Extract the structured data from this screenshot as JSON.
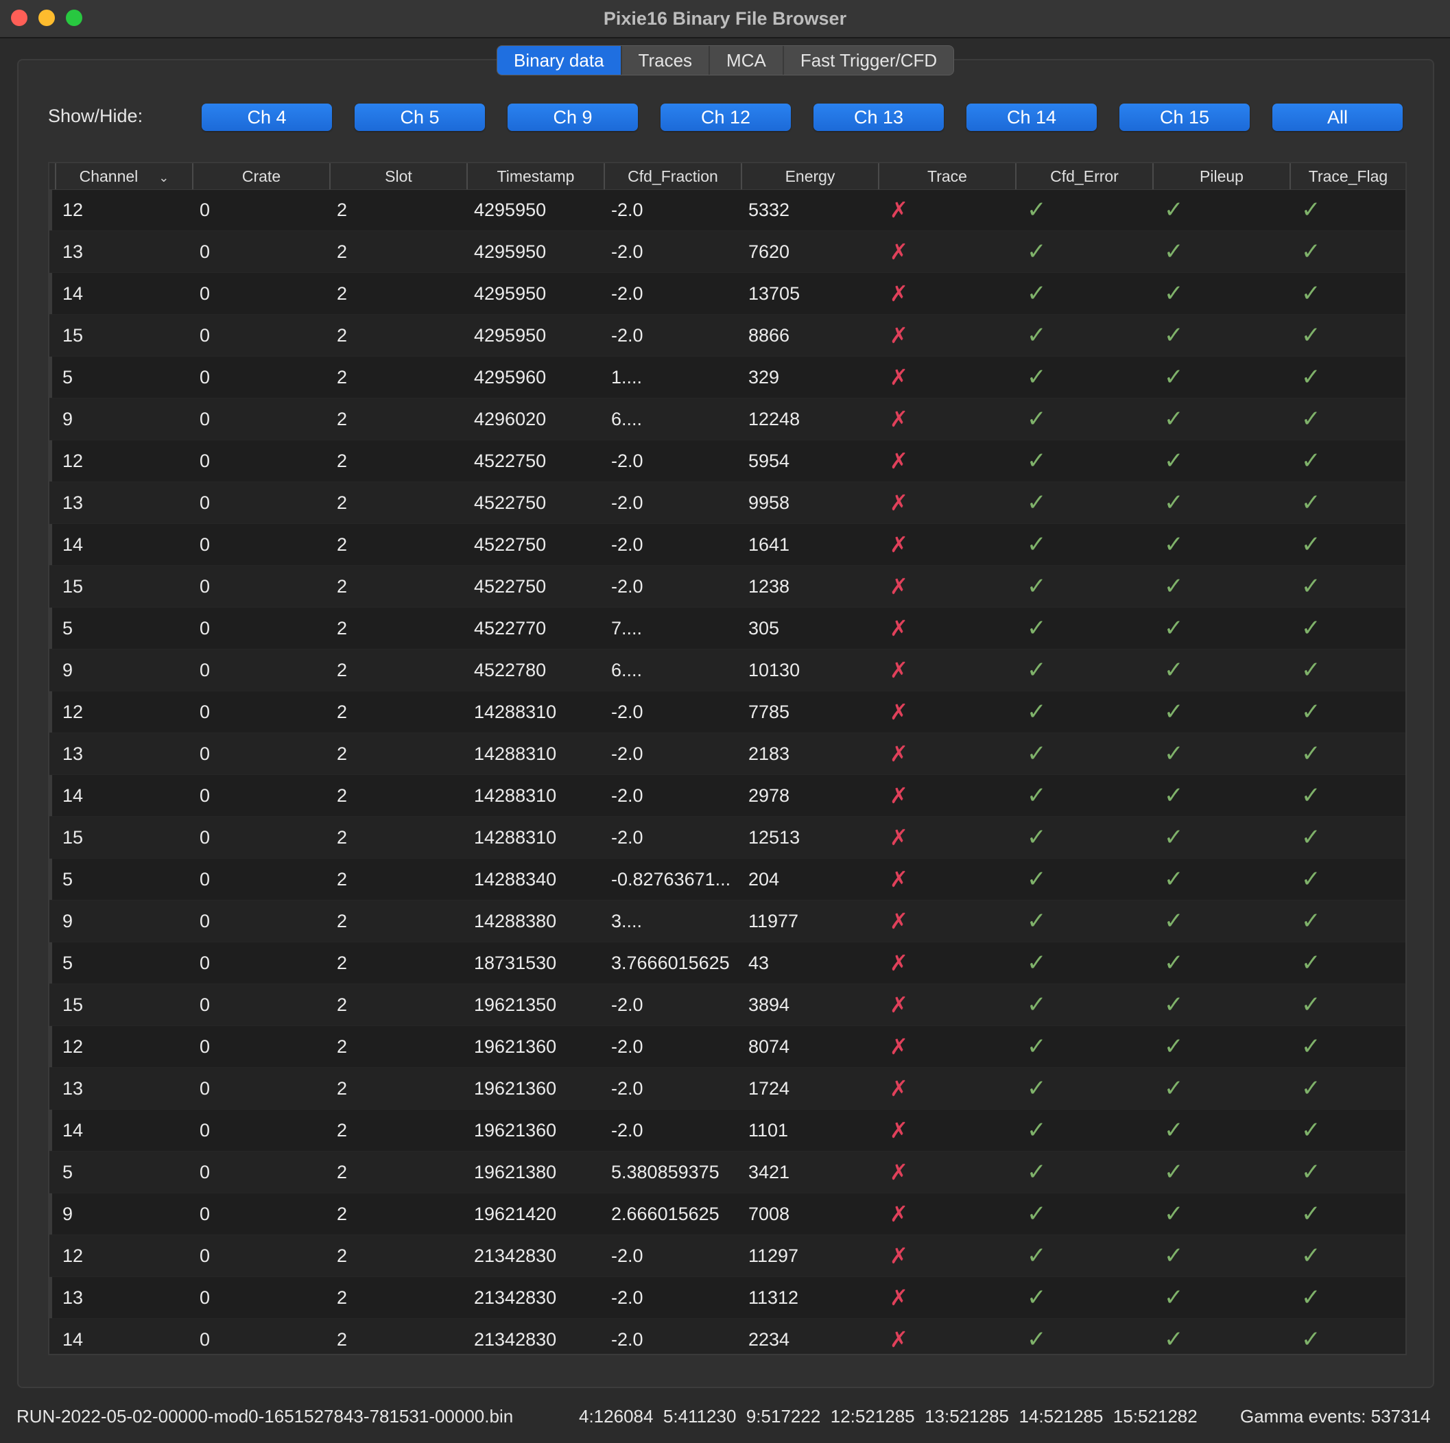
{
  "window": {
    "title": "Pixie16 Binary File Browser"
  },
  "tabs": [
    {
      "label": "Binary data",
      "active": true
    },
    {
      "label": "Traces",
      "active": false
    },
    {
      "label": "MCA",
      "active": false
    },
    {
      "label": "Fast Trigger/CFD",
      "active": false
    }
  ],
  "show_hide": {
    "label": "Show/Hide:",
    "buttons": [
      "Ch 4",
      "Ch 5",
      "Ch 9",
      "Ch 12",
      "Ch 13",
      "Ch 14",
      "Ch 15",
      "All"
    ]
  },
  "table": {
    "columns": [
      "Channel",
      "Crate",
      "Slot",
      "Timestamp",
      "Cfd_Fraction",
      "Energy",
      "Trace",
      "Cfd_Error",
      "Pileup",
      "Trace_Flag"
    ],
    "sort_column": "Channel",
    "rows": [
      [
        "12",
        "0",
        "2",
        "4295950",
        "-2.0",
        "5332"
      ],
      [
        "13",
        "0",
        "2",
        "4295950",
        "-2.0",
        "7620"
      ],
      [
        "14",
        "0",
        "2",
        "4295950",
        "-2.0",
        "13705"
      ],
      [
        "15",
        "0",
        "2",
        "4295950",
        "-2.0",
        "8866"
      ],
      [
        "5",
        "0",
        "2",
        "4295960",
        "1....",
        "329"
      ],
      [
        "9",
        "0",
        "2",
        "4296020",
        "6....",
        "12248"
      ],
      [
        "12",
        "0",
        "2",
        "4522750",
        "-2.0",
        "5954"
      ],
      [
        "13",
        "0",
        "2",
        "4522750",
        "-2.0",
        "9958"
      ],
      [
        "14",
        "0",
        "2",
        "4522750",
        "-2.0",
        "1641"
      ],
      [
        "15",
        "0",
        "2",
        "4522750",
        "-2.0",
        "1238"
      ],
      [
        "5",
        "0",
        "2",
        "4522770",
        "7....",
        "305"
      ],
      [
        "9",
        "0",
        "2",
        "4522780",
        "6....",
        "10130"
      ],
      [
        "12",
        "0",
        "2",
        "14288310",
        "-2.0",
        "7785"
      ],
      [
        "13",
        "0",
        "2",
        "14288310",
        "-2.0",
        "2183"
      ],
      [
        "14",
        "0",
        "2",
        "14288310",
        "-2.0",
        "2978"
      ],
      [
        "15",
        "0",
        "2",
        "14288310",
        "-2.0",
        "12513"
      ],
      [
        "5",
        "0",
        "2",
        "14288340",
        "-0.82763671...",
        "204"
      ],
      [
        "9",
        "0",
        "2",
        "14288380",
        "3....",
        "11977"
      ],
      [
        "5",
        "0",
        "2",
        "18731530",
        "3.7666015625",
        "43"
      ],
      [
        "15",
        "0",
        "2",
        "19621350",
        "-2.0",
        "3894"
      ],
      [
        "12",
        "0",
        "2",
        "19621360",
        "-2.0",
        "8074"
      ],
      [
        "13",
        "0",
        "2",
        "19621360",
        "-2.0",
        "1724"
      ],
      [
        "14",
        "0",
        "2",
        "19621360",
        "-2.0",
        "1101"
      ],
      [
        "5",
        "0",
        "2",
        "19621380",
        "5.380859375",
        "3421"
      ],
      [
        "9",
        "0",
        "2",
        "19621420",
        "2.666015625",
        "7008"
      ],
      [
        "12",
        "0",
        "2",
        "21342830",
        "-2.0",
        "11297"
      ],
      [
        "13",
        "0",
        "2",
        "21342830",
        "-2.0",
        "11312"
      ],
      [
        "14",
        "0",
        "2",
        "21342830",
        "-2.0",
        "2234"
      ]
    ],
    "flag_icons": {
      "trace": "cross-icon",
      "cfd_error": "check-icon",
      "pileup": "check-icon",
      "trace_flag": "check-icon"
    }
  },
  "status": {
    "filename": "RUN-2022-05-02-00000-mod0-1651527843-781531-00000.bin",
    "counts": "4:126084  5:411230  9:517222  12:521285  13:521285  14:521285  15:521282",
    "gamma": "Gamma events: 537314"
  },
  "colors": {
    "accent": "#1f6fe0",
    "cross": "#e0405a",
    "check": "#7fb26a",
    "background": "#2b2b2b"
  }
}
